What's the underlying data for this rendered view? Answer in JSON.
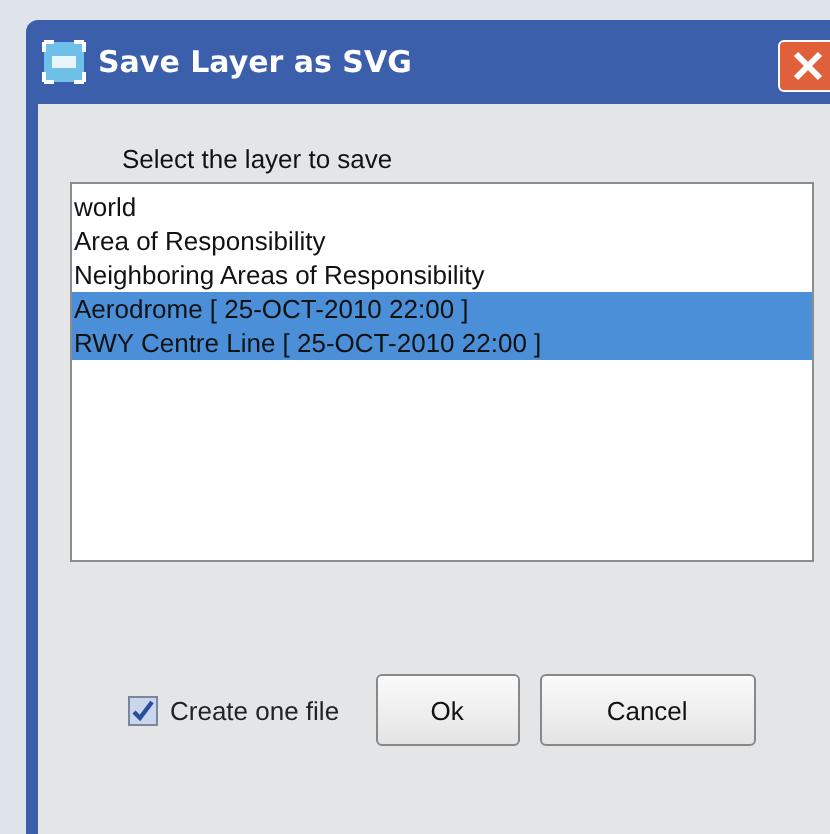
{
  "window": {
    "title": "Save Layer as SVG"
  },
  "prompt": "Select the layer to save",
  "layers": [
    {
      "label": "world",
      "selected": false
    },
    {
      "label": "Area of Responsibility",
      "selected": false
    },
    {
      "label": "Neighboring Areas of Responsibility",
      "selected": false
    },
    {
      "label": "Aerodrome [ 25-OCT-2010 22:00 ]",
      "selected": true
    },
    {
      "label": "RWY Centre Line [ 25-OCT-2010 22:00 ]",
      "selected": true
    }
  ],
  "create_one_file": {
    "label": "Create one file",
    "checked": true
  },
  "buttons": [
    "Ok",
    "Cancel"
  ]
}
